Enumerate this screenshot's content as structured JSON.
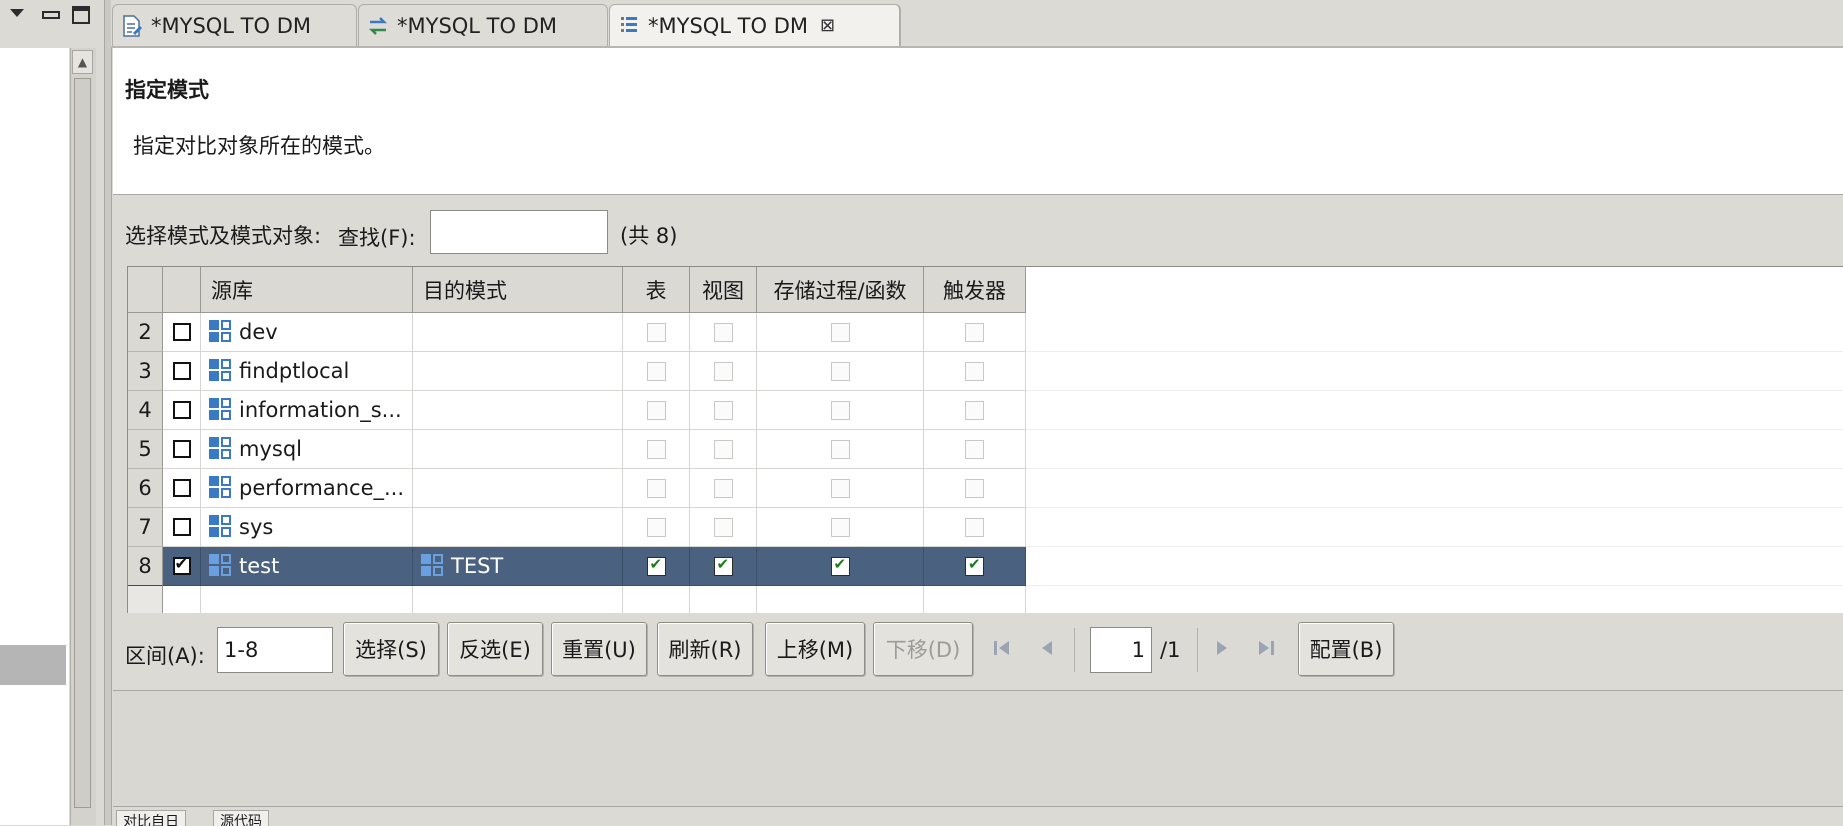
{
  "tabs": [
    {
      "label": "*MYSQL TO DM",
      "icon": "document-edit-icon"
    },
    {
      "label": "*MYSQL TO DM",
      "icon": "sync-arrows-icon"
    },
    {
      "label": "*MYSQL TO DM",
      "icon": "list-document-icon",
      "active": true,
      "close": "⊠"
    }
  ],
  "header": {
    "title": "指定模式",
    "description": "指定对比对象所在的模式。"
  },
  "filter": {
    "select_label": "选择模式及模式对象:",
    "find_label": "查找(F):",
    "find_value": "",
    "total": "(共 8)"
  },
  "table": {
    "columns": [
      "源库",
      "目的模式",
      "表",
      "视图",
      "存储过程/函数",
      "触发器"
    ],
    "rows": [
      {
        "num": "2",
        "checked": false,
        "source": "dev",
        "target": "",
        "table": false,
        "view": false,
        "proc": false,
        "trigger": false
      },
      {
        "num": "3",
        "checked": false,
        "source": "findptlocal",
        "target": "",
        "table": false,
        "view": false,
        "proc": false,
        "trigger": false
      },
      {
        "num": "4",
        "checked": false,
        "source": "information_s...",
        "target": "",
        "table": false,
        "view": false,
        "proc": false,
        "trigger": false
      },
      {
        "num": "5",
        "checked": false,
        "source": "mysql",
        "target": "",
        "table": false,
        "view": false,
        "proc": false,
        "trigger": false
      },
      {
        "num": "6",
        "checked": false,
        "source": "performance_...",
        "target": "",
        "table": false,
        "view": false,
        "proc": false,
        "trigger": false
      },
      {
        "num": "7",
        "checked": false,
        "source": "sys",
        "target": "",
        "table": false,
        "view": false,
        "proc": false,
        "trigger": false
      },
      {
        "num": "8",
        "checked": true,
        "source": "test",
        "target": "TEST",
        "table": true,
        "view": true,
        "proc": true,
        "trigger": true,
        "selected": true
      }
    ]
  },
  "toolbar": {
    "range_label": "区间(A):",
    "range_value": "1-8",
    "select": "选择(S)",
    "invert": "反选(E)",
    "reset": "重置(U)",
    "refresh": "刷新(R)",
    "move_up": "上移(M)",
    "move_down": "下移(D)",
    "page_current": "1",
    "page_total": "/1",
    "config": "配置(B)"
  },
  "bottom_tabs": [
    "对比自日",
    "源代码"
  ],
  "colors": {
    "selection": "#4b6180",
    "icon_blue": "#3a79c4",
    "check_green": "#1e7a1e"
  }
}
